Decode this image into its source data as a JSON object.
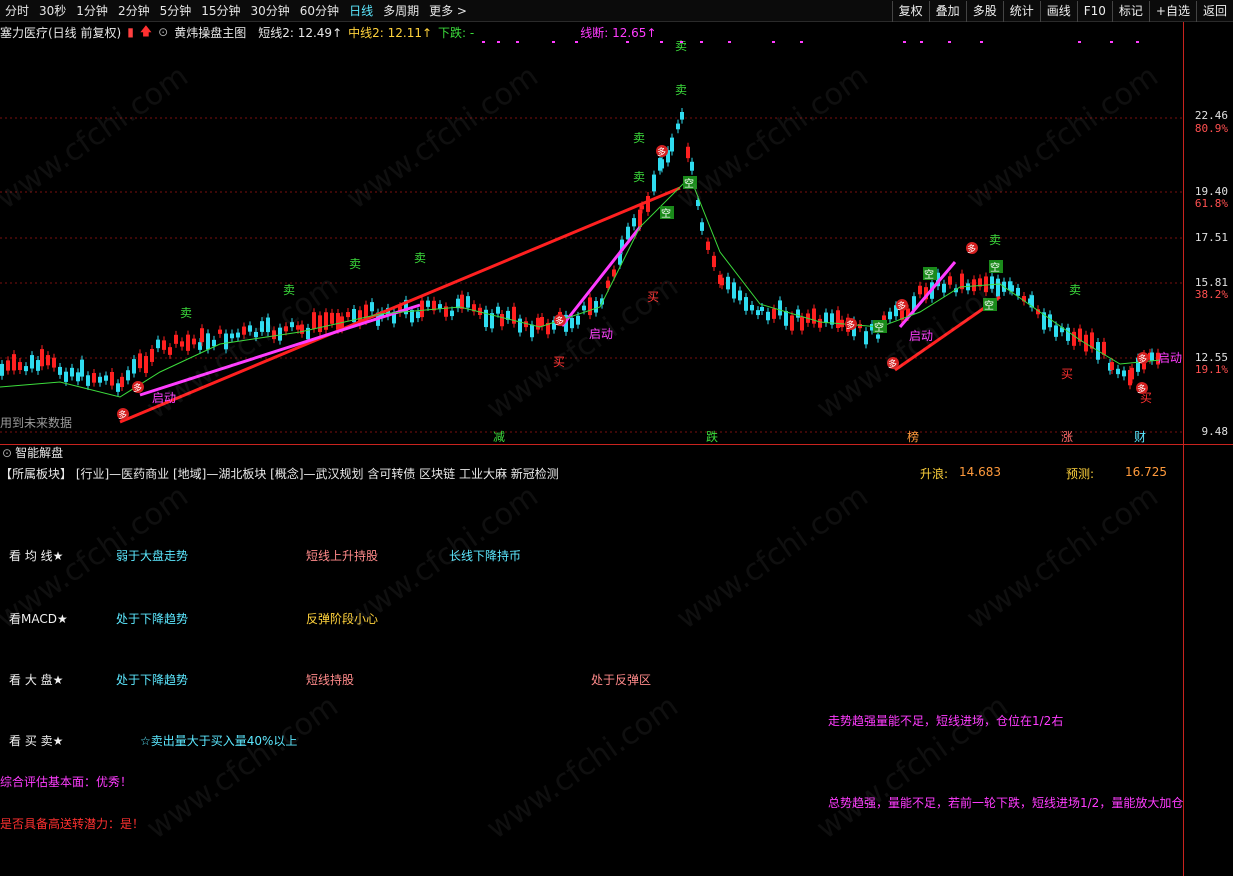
{
  "toolbar": {
    "periods": [
      "分时",
      "30秒",
      "1分钟",
      "2分钟",
      "5分钟",
      "15分钟",
      "30分钟",
      "60分钟",
      "日线",
      "多周期",
      "更多 >"
    ],
    "active_period": "日线",
    "buttons": [
      "复权",
      "叠加",
      "多股",
      "统计",
      "画线",
      "F10",
      "标记",
      "+自选",
      "返回"
    ]
  },
  "info": {
    "stock": "塞力医疗(日线 前复权)",
    "indicator": "黄炜操盘主图",
    "short_line": "短线2: 12.49↑",
    "mid_line": "中线2: 12.11↑",
    "down": "下跌: -",
    "line_break": "线断: 12.65↑"
  },
  "price_axis": {
    "ticks": [
      "22.46",
      "19.40",
      "17.51",
      "15.81",
      "12.55",
      "9.48"
    ],
    "pcts": [
      "80.9%",
      "61.8%",
      "38.2%",
      "19.1%"
    ]
  },
  "chart": {
    "signals": {
      "buy": "买",
      "sell": "卖",
      "many": "多",
      "empty": "空",
      "start": "启动"
    },
    "bottom_tags": [
      "减",
      "跌",
      "榜",
      "涨",
      "财"
    ],
    "future_note": "用到未来数据"
  },
  "panel": {
    "title": "智能解盘",
    "sector": "【所属板块】 [行业]—医药商业 [地域]—湖北板块 [概念]—武汉规划 含可转债 区块链 工业大麻 新冠检测",
    "rise_label": "升浪:",
    "rise_value": "14.683",
    "predict_label": "预测:",
    "predict_value": "16.725",
    "rows": [
      {
        "label": "看 均 线★",
        "c1": "弱于大盘走势",
        "c2": "短线上升持股",
        "c3": "长线下降持币"
      },
      {
        "label": "看MACD★",
        "c1": "处于下降趋势",
        "c2": "反弹阶段小心"
      },
      {
        "label": "看 大 盘★",
        "c1": "处于下降趋势",
        "c2": "短线持股",
        "c3": "处于反弹区"
      },
      {
        "label": "看 买 卖★",
        "c1": "☆卖出量大于买入量40%以上"
      }
    ],
    "advice1": "走势趋强量能不足，短线进场，仓位在1/2右",
    "fundamental": "综合评估基本面：优秀！",
    "advice2": "总势趋强，量能不足，若前一轮下跌，短线进场1/2，量能放大加仓",
    "transfer": "是否具备高送转潜力：是！"
  },
  "watermark": "www.cfchi.com"
}
